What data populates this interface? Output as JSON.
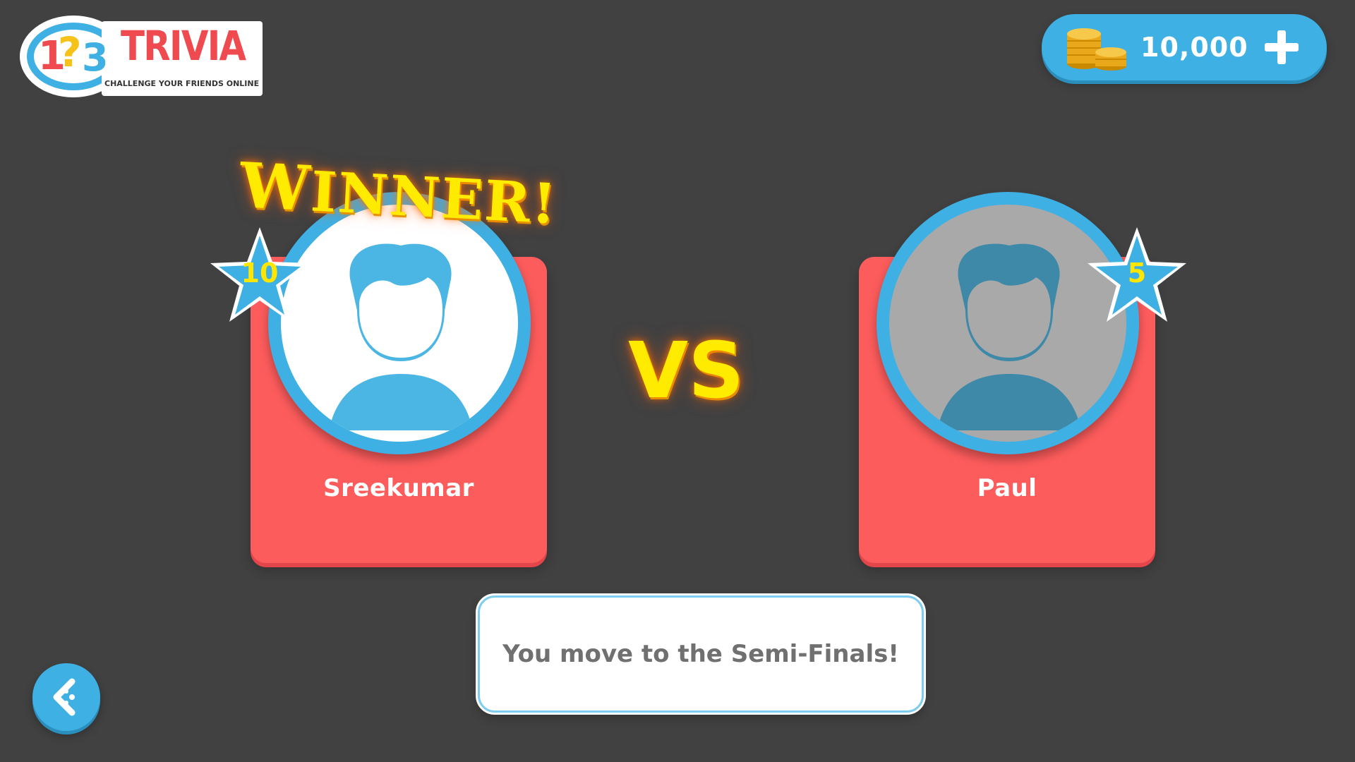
{
  "app": {
    "logo_title": "TRIVIA",
    "logo_numbers": "1?3",
    "logo_tagline": "CHALLENGE YOUR FRIENDS ONLINE"
  },
  "wallet": {
    "coins": "10,000",
    "coin_icon": "coin-stack-icon",
    "add_icon": "plus-icon"
  },
  "match": {
    "winner_label": "Winner!",
    "vs_label": "VS",
    "players": [
      {
        "name": "Sreekumar",
        "score": "10",
        "is_winner": true,
        "avatar_bg": "#ffffff",
        "avatar_fg": "#4bb6e4"
      },
      {
        "name": "Paul",
        "score": "5",
        "is_winner": false,
        "avatar_bg": "#a9a9a9",
        "avatar_fg": "#3e88a8"
      }
    ],
    "result_message": "You move to the Semi-Finals!"
  },
  "navigation": {
    "back_icon": "back-arrow-icon"
  },
  "colors": {
    "background": "#414141",
    "card": "#fd5c5c",
    "accent_blue": "#3fb0e3",
    "highlight_yellow": "#ffeb00"
  }
}
